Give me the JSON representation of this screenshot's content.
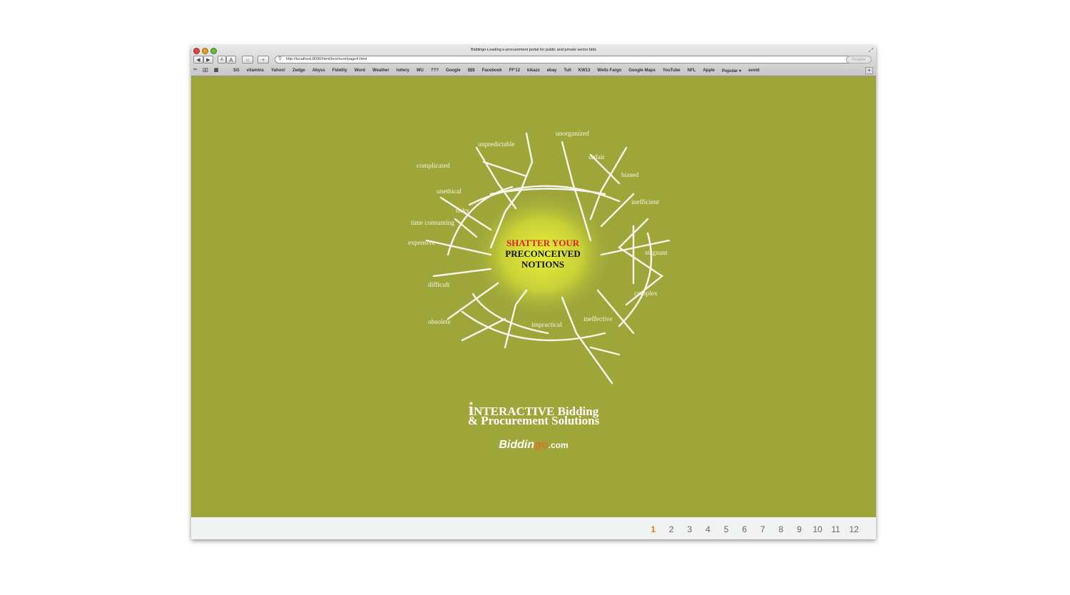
{
  "window": {
    "title": "Biddingo-Leading e-procurement portal for public and private sector bids",
    "url": "http://localhost:8090/html/brochure/page4.html",
    "reader_label": "Reader"
  },
  "toolbar": {
    "back_icon": "back-arrow-icon",
    "forward_icon": "forward-arrow-icon",
    "text_smaller": "A",
    "text_bigger": "A",
    "home_icon": "home-icon",
    "add_icon": "plus-icon"
  },
  "bookmarks": [
    "SG",
    "vitamins",
    "Yahoo!",
    "Zedge",
    "Abyss",
    "Fidelity",
    "Word",
    "Weather",
    "lottery",
    "WU",
    "???",
    "Google",
    "$$$",
    "Facebook",
    "FF'12",
    "kikazz",
    "ebay",
    "Tull",
    "KW13",
    "Wells Fargo",
    "Google Maps",
    "YouTube",
    "NFL",
    "Apple",
    "Popular ▾",
    "avoid"
  ],
  "graphic": {
    "headline_1": "SHATTER YOUR",
    "headline_2": "PRECONCEIVED",
    "headline_3": "NOTIONS",
    "words": {
      "unorganized": "unorganized",
      "unpredictable": "unpredictable",
      "unfair": "unfair",
      "complicated": "complicated",
      "biased": "biased",
      "unethical": "unethical",
      "inefficient": "inefficient",
      "risky": "risky",
      "time_consuming": "time consuming",
      "expensive": "expensive",
      "stagnant": "stagnant",
      "difficult": "difficult",
      "complex": "complex",
      "ineffective": "ineffective",
      "obsolete": "obsolete",
      "impractical": "impractical"
    }
  },
  "brand": {
    "big_i": "i",
    "line1_rest": "NTERACTIVE Bidding",
    "line2": "& Procurement Solutions",
    "logo_part1": "Biddin",
    "logo_part2": "go",
    "logo_part3": ".com"
  },
  "pagination": {
    "current": "1",
    "pages": [
      "1",
      "2",
      "3",
      "4",
      "5",
      "6",
      "7",
      "8",
      "9",
      "10",
      "11",
      "12"
    ]
  },
  "colors": {
    "background": "#9ea63a",
    "accent_red": "#e02020",
    "active_page": "#e07b16"
  }
}
